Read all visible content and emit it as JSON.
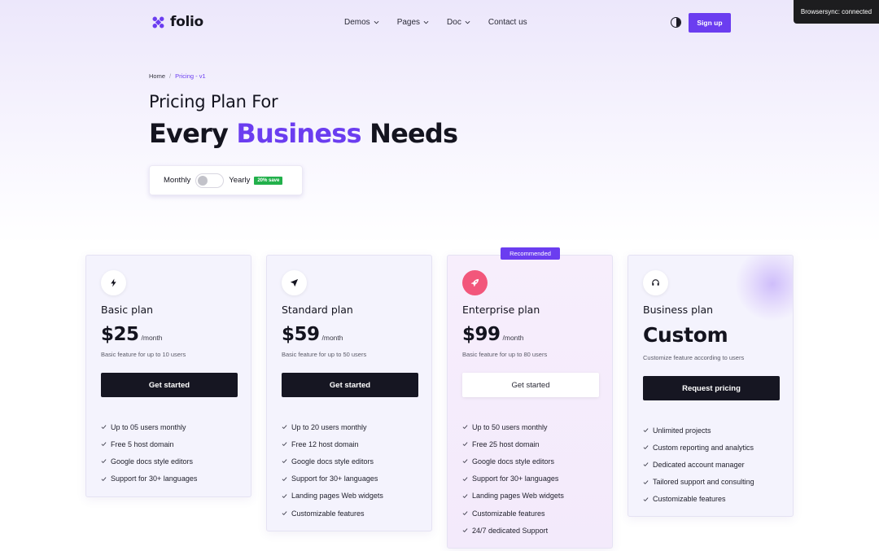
{
  "header": {
    "brand": "folio",
    "nav": [
      {
        "label": "Demos",
        "has_dropdown": true
      },
      {
        "label": "Pages",
        "has_dropdown": true
      },
      {
        "label": "Doc",
        "has_dropdown": true
      },
      {
        "label": "Contact us",
        "has_dropdown": false
      }
    ],
    "theme_icon": "contrast-icon",
    "signup_label": "Sign up"
  },
  "toast": "Browsersync: connected",
  "breadcrumb": {
    "home": "Home",
    "separator": "/",
    "current": "Pricing - v1"
  },
  "hero": {
    "line1": "Pricing Plan For",
    "line2_before": "Every",
    "line2_accent": "Business",
    "line2_after": "Needs"
  },
  "billing": {
    "monthly": "Monthly",
    "yearly": "Yearly",
    "save_badge": "20% save",
    "yearly_selected": false
  },
  "plans": [
    {
      "name": "Basic plan",
      "icon": "lightning-icon",
      "price": "$25",
      "period": "/month",
      "description": "Basic feature for up to 10 users",
      "cta": "Get started",
      "features": [
        "Up to 05 users monthly",
        "Free 5 host domain",
        "Google docs style editors",
        "Support for 30+ languages"
      ]
    },
    {
      "name": "Standard plan",
      "icon": "send-icon",
      "price": "$59",
      "period": "/month",
      "description": "Basic feature for up to 50 users",
      "cta": "Get started",
      "features": [
        "Up to 20 users monthly",
        "Free 12 host domain",
        "Google docs style editors",
        "Support for 30+ languages",
        "Landing pages Web widgets",
        "Customizable features"
      ]
    },
    {
      "name": "Enterprise plan",
      "icon": "rocket-icon",
      "price": "$99",
      "period": "/month",
      "description": "Basic feature for up to 80 users",
      "cta": "Get started",
      "badge": "Recommended",
      "features": [
        "Up to 50 users monthly",
        "Free 25 host domain",
        "Google docs style editors",
        "Support for 30+ languages",
        "Landing pages Web widgets",
        "Customizable features",
        "24/7 dedicated Support"
      ]
    },
    {
      "name": "Business plan",
      "icon": "headset-icon",
      "price": "Custom",
      "description": "Customize feature according to users",
      "cta": "Request pricing",
      "features": [
        "Unlimited projects",
        "Custom reporting and analytics",
        "Dedicated account manager",
        "Tailored support and consulting",
        "Customizable features"
      ]
    }
  ],
  "colors": {
    "accent": "#6b3df0",
    "dark": "#161622",
    "badge_green": "#22b04b",
    "enterprise_icon": "#f2577b"
  }
}
